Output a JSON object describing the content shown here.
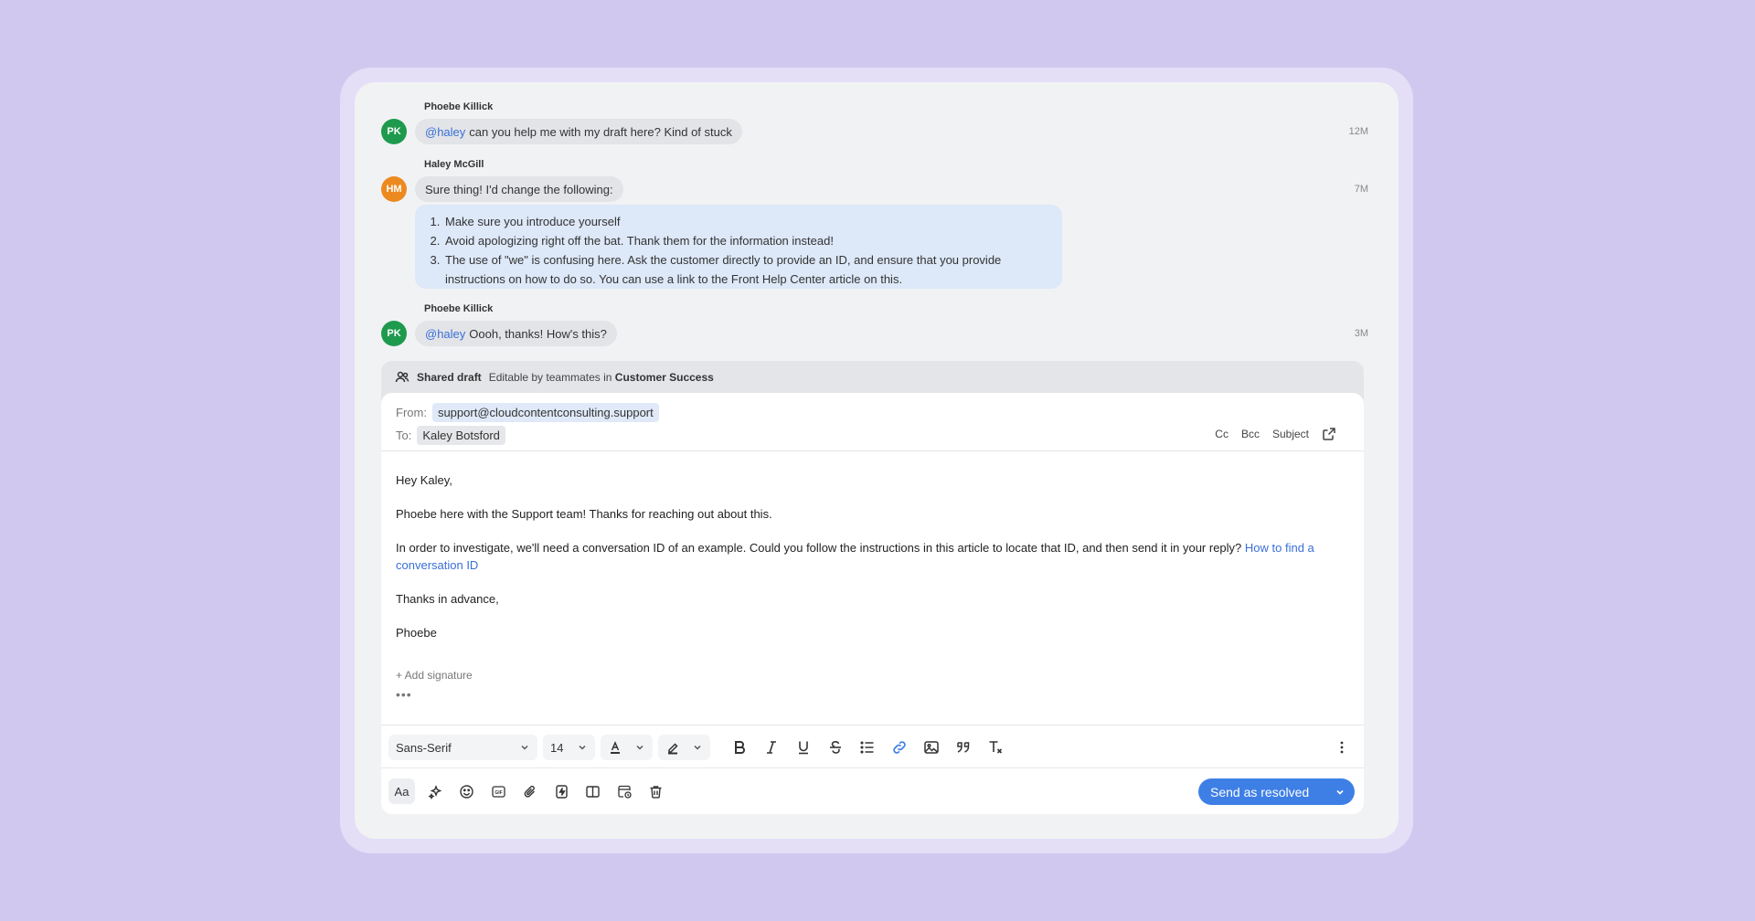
{
  "messages": [
    {
      "author": "Phoebe Killick",
      "initials": "PK",
      "mention": "@haley",
      "text": "can you help me with my draft here? Kind of stuck",
      "time": "12M"
    },
    {
      "author": "Haley McGill",
      "initials": "HM",
      "text": "Sure thing! I'd change the following:",
      "time": "7M",
      "list": [
        "Make sure you introduce yourself",
        "Avoid apologizing right off the bat. Thank them for the information instead!",
        "The use of \"we\" is confusing here. Ask the customer directly to provide an ID, and ensure that you provide instructions on how to do so. You can use a link to the Front Help Center article on this."
      ]
    },
    {
      "author": "Phoebe Killick",
      "initials": "PK",
      "mention": "@haley",
      "text": "Oooh, thanks! How's this?",
      "time": "3M"
    }
  ],
  "draft": {
    "label": "Shared draft",
    "editable_prefix": "Editable by teammates in",
    "team": "Customer Success",
    "from_label": "From:",
    "from_value": "support@cloudcontentconsulting.support",
    "to_label": "To:",
    "to_value": "Kaley Botsford",
    "cc": "Cc",
    "bcc": "Bcc",
    "subject": "Subject",
    "body": {
      "greeting": "Hey Kaley,",
      "line1": "Phoebe here with the Support team! Thanks for reaching out about this.",
      "line2": "In order to investigate, we'll need a conversation ID of an example. Could you follow the instructions in this article to locate that ID, and then send it in your reply?",
      "link": "How to find a conversation ID",
      "closing": "Thanks in advance,",
      "signature": "Phoebe"
    },
    "add_signature": "+ Add signature",
    "ellipsis": "•••"
  },
  "toolbar": {
    "font_family": "Sans-Serif",
    "font_size": "14",
    "send_label": "Send as resolved",
    "aa_label": "Aa"
  },
  "colors": {
    "accent": "#3e7fe6",
    "mention": "#3a6fd8",
    "avatar_pk": "#1e9a4e",
    "avatar_hm": "#ec8a1f"
  }
}
